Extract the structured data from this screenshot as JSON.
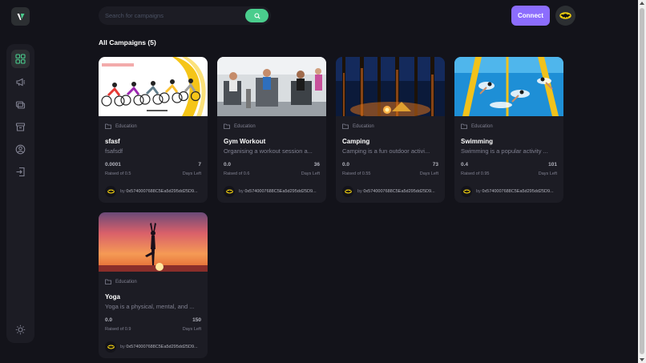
{
  "header": {
    "search_placeholder": "Search for campaigns",
    "connect_label": "Connect",
    "heading": "All Campaigns (5)"
  },
  "icons": {
    "logo": "logo-icon",
    "sidebar": [
      "dashboard-icon",
      "campaign-icon",
      "payment-icon",
      "withdraw-icon",
      "profile-icon",
      "logout-icon",
      "sun-icon"
    ],
    "search": "search-icon",
    "folder": "folder-icon",
    "profile": "batman-avatar-icon"
  },
  "colors": {
    "background": "#13131a",
    "panel": "#1c1c24",
    "accent_green": "#4acd8d",
    "accent_purple": "#8c6dfd",
    "muted_text": "#808191"
  },
  "campaigns": [
    {
      "category": "Education",
      "title": "sfasf",
      "description": "fsafsdf",
      "raised": "0.0001",
      "raised_label": "Raised of 0.5",
      "days": "7",
      "days_label": "Days Left",
      "owner_prefix": "by",
      "owner": "0x5740007688C5Ea5d295dd25D9...",
      "image": "cyclists"
    },
    {
      "category": "Education",
      "title": "Gym Workout",
      "description": "Organising a workout session a...",
      "raised": "0.0",
      "raised_label": "Raised of 0.6",
      "days": "36",
      "days_label": "Days Left",
      "owner_prefix": "by",
      "owner": "0x5740007688C5Ea5d295dd25D9...",
      "image": "gym"
    },
    {
      "category": "Education",
      "title": "Camping",
      "description": "Camping is a fun outdoor activi...",
      "raised": "0.0",
      "raised_label": "Raised of 0.55",
      "days": "73",
      "days_label": "Days Left",
      "owner_prefix": "by",
      "owner": "0x5740007688C5Ea5d295dd25D9...",
      "image": "camping"
    },
    {
      "category": "Education",
      "title": "Swimming",
      "description": "Swimming is a popular activity ...",
      "raised": "0.4",
      "raised_label": "Raised of 0.95",
      "days": "101",
      "days_label": "Days Left",
      "owner_prefix": "by",
      "owner": "0x5740007688C5Ea5d295dd25D9...",
      "image": "swimming"
    },
    {
      "category": "Education",
      "title": "Yoga",
      "description": "Yoga is a physical, mental, and ...",
      "raised": "0.0",
      "raised_label": "Raised of 0.9",
      "days": "150",
      "days_label": "Days Left",
      "owner_prefix": "by",
      "owner": "0x5740007688C5Ea5d295dd25D9...",
      "image": "yoga"
    }
  ]
}
